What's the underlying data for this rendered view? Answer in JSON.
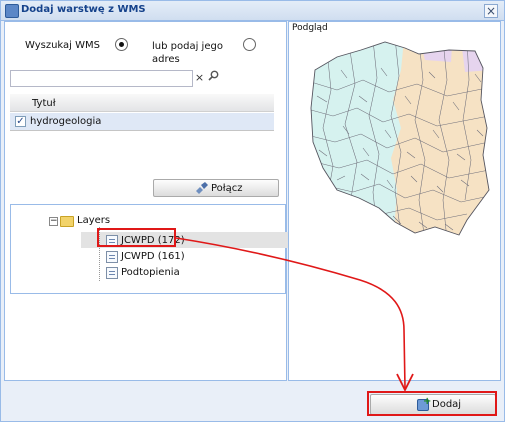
{
  "window": {
    "title": "Dodaj warstwę z WMS",
    "close_label": "×"
  },
  "search_mode": {
    "option_search_label": "Wyszukaj WMS",
    "option_search_selected": true,
    "option_address_label": "lub podaj jego adres",
    "option_address_selected": false
  },
  "search": {
    "value": "",
    "clear_icon": "clear-icon",
    "search_icon": "search-icon"
  },
  "grid": {
    "header": "Tytuł",
    "rows": [
      {
        "title": "hydrogeologia",
        "checked": true
      }
    ]
  },
  "connect_button": "Połącz",
  "tree": {
    "root": "Layers",
    "items": [
      "JCWPD (172)",
      "JCWPD (161)",
      "Podtopienia"
    ],
    "selected_index": 0
  },
  "preview": {
    "label": "Podgląd"
  },
  "add_button": "Dodaj",
  "colors": {
    "window_border": "#99bbe8",
    "title_text": "#15428b",
    "highlight_red": "#e01818",
    "map_cyan": "#d6f2ef",
    "map_beige": "#f6e2c4",
    "map_violet": "#e6d4ee",
    "map_lines": "#6e6e7a"
  }
}
